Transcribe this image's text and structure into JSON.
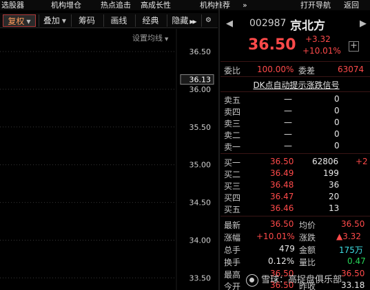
{
  "menu": [
    {
      "label": "选股器"
    },
    {
      "label": "机构增仓"
    },
    {
      "label": "热点追击"
    },
    {
      "label": "高成长性"
    },
    {
      "label": "机构推荐"
    },
    {
      "label": "»"
    },
    {
      "label": "打开导航"
    },
    {
      "label": "返回"
    }
  ],
  "toolbar": {
    "restore": "复权",
    "overlay": "叠加",
    "chips": "筹码",
    "draw": "画线",
    "classic": "经典",
    "hide": "隐藏"
  },
  "chart": {
    "ma_setting": "设置均线",
    "price_ticks": [
      "36.50",
      "36.00",
      "35.50",
      "35.00",
      "34.50",
      "34.00",
      "33.50"
    ],
    "current_price_label": "36.13",
    "gridlines": [
      36.5,
      36.0,
      35.5,
      35.0,
      34.5,
      34.0,
      33.5
    ],
    "y_range": [
      33.34,
      36.8
    ]
  },
  "stock": {
    "code": "002987",
    "name": "京北方",
    "price": "36.50",
    "change": "+3.32",
    "change_pct": "+10.01%"
  },
  "commission": {
    "ratio_label": "委比",
    "ratio_value": "100.00%",
    "diff_label": "委差",
    "diff_value": "63074"
  },
  "signal_button": "DK点自动提示涨跌信号",
  "sell_orders": [
    {
      "label": "卖五",
      "price": "—",
      "volume": "0"
    },
    {
      "label": "卖四",
      "price": "—",
      "volume": "0"
    },
    {
      "label": "卖三",
      "price": "—",
      "volume": "0"
    },
    {
      "label": "卖二",
      "price": "—",
      "volume": "0"
    },
    {
      "label": "卖一",
      "price": "—",
      "volume": "0"
    }
  ],
  "buy_orders": [
    {
      "label": "买一",
      "price": "36.50",
      "volume": "62806",
      "delta": "+2"
    },
    {
      "label": "买二",
      "price": "36.49",
      "volume": "199",
      "delta": ""
    },
    {
      "label": "买三",
      "price": "36.48",
      "volume": "36",
      "delta": ""
    },
    {
      "label": "买四",
      "price": "36.47",
      "volume": "20",
      "delta": ""
    },
    {
      "label": "买五",
      "price": "36.46",
      "volume": "13",
      "delta": ""
    }
  ],
  "stats": {
    "latest_label": "最新",
    "latest_value": "36.50",
    "avg_label": "均价",
    "avg_value": "36.50",
    "pct_label": "涨幅",
    "pct_value": "+10.01%",
    "chg_label": "涨跌",
    "chg_value": "▲3.32",
    "total_label": "总手",
    "total_value": "479",
    "amount_label": "金额",
    "amount_value": "175万",
    "turnover_label": "换手",
    "turnover_value": "0.12%",
    "volratio_label": "量比",
    "volratio_value": "0.47",
    "high_label": "最高",
    "high_value": "36.50",
    "low_value": "36.50",
    "open_label": "今开",
    "open_value": "36.50",
    "prevclose_label": "昨收",
    "prevclose_value": "33.18"
  },
  "watermark": "雪球：高捉盘俱乐部",
  "colors": {
    "up": "#ff4a4a",
    "down": "#26d458",
    "neutral": "#c8c8c8",
    "accent": "#ff9a5a"
  }
}
